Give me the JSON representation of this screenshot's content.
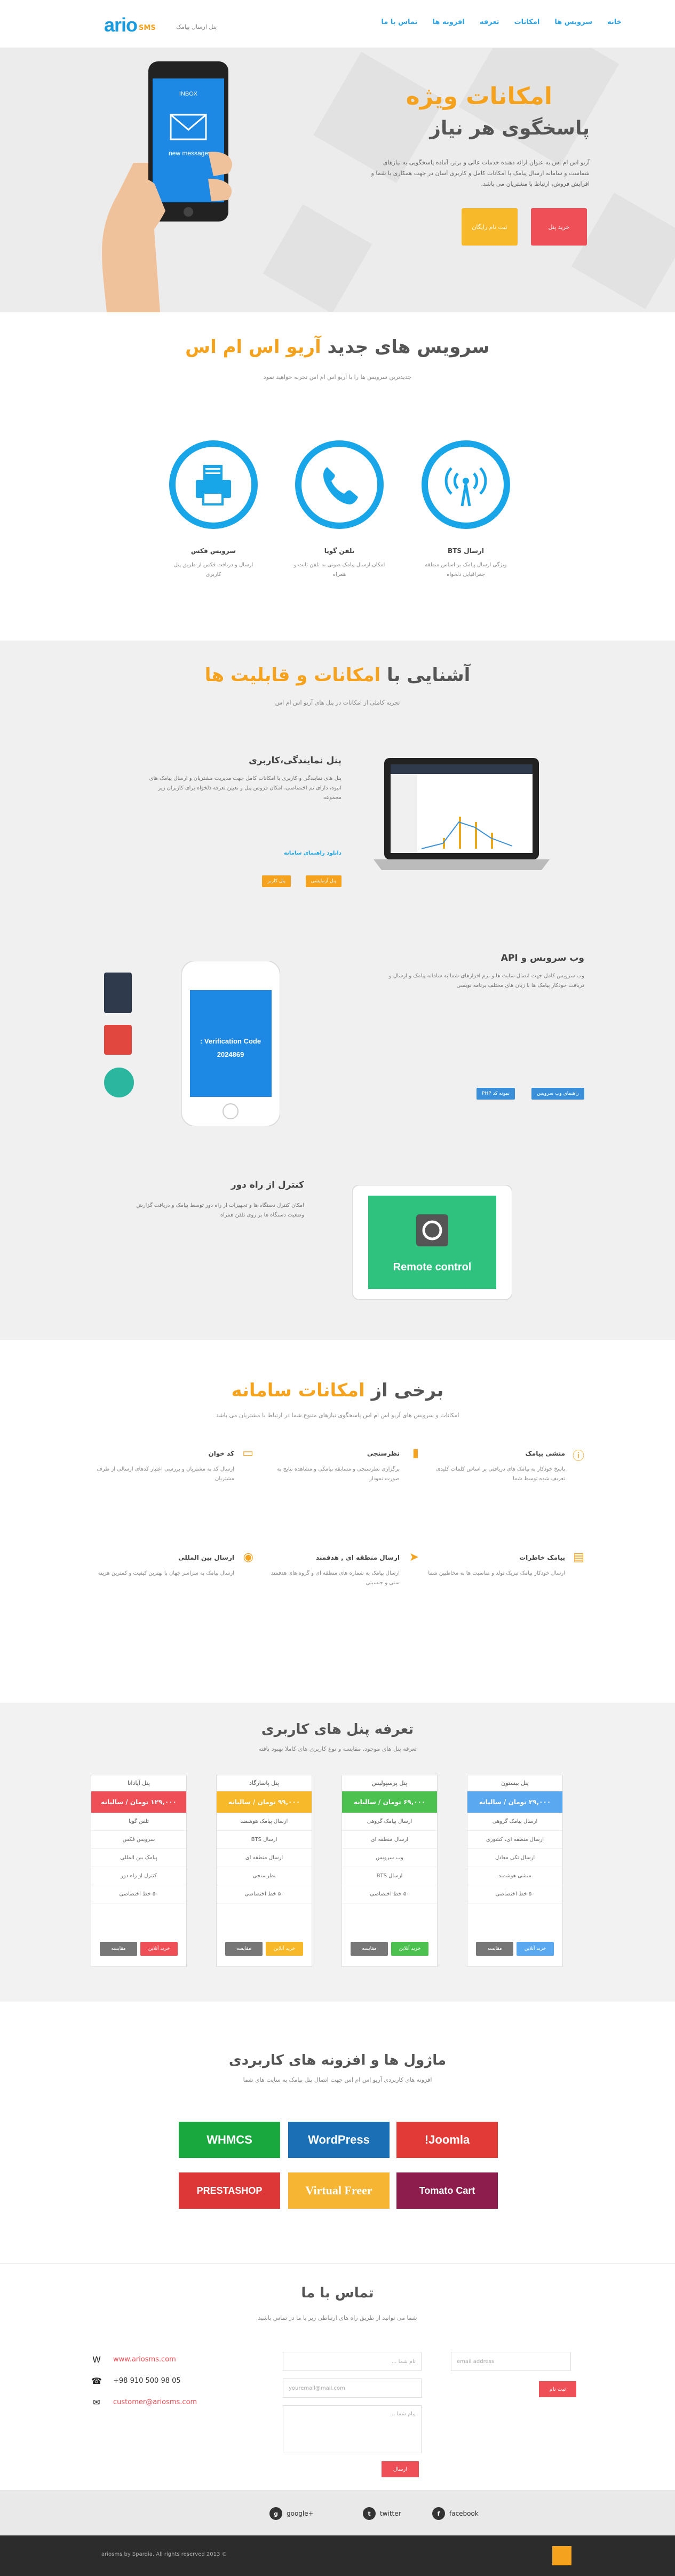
{
  "header": {
    "nav": [
      "خانه",
      "سرویس ها",
      "امکانات",
      "تعرفه",
      "افزونه ها",
      "تماس با ما"
    ],
    "logo_main": "ario",
    "logo_sub": "SMS",
    "tagline": "پنل ارسال پیامک"
  },
  "hero": {
    "title_line1": "امکانات ویژه",
    "title_line2": "پاسخگوی هر نیاز",
    "description": "آریو اس ام اس به عنوان ارائه دهنده خدمات عالی و برتر، آماده پاسخگویی به نیازهای شماست و سامانه ارسال پیامک با امکانات کامل و کاربری آسان در جهت همکاری با شما و افزایش فروش، ارتباط با مشتریان می باشد.",
    "btn_register": "ثبت نام رایگان",
    "btn_buy": "خرید پنل",
    "phone_inbox": "INBOX",
    "phone_msg": "new message"
  },
  "services": {
    "title_a": "سرویس های جدید",
    "title_b": "آریو اس ام اس",
    "subtitle": "جدیدترین سرویس ها را با آریو اس ام اس تجربه خواهید نمود",
    "items": [
      {
        "title": "ارسال BTS",
        "desc": "ویژگی ارسال پیامک بر اساس منطقه جغرافیایی دلخواه"
      },
      {
        "title": "تلفن گویا",
        "desc": "امکان ارسال پیامک صوتی به تلفن ثابت و همراه"
      },
      {
        "title": "سرویس فکس",
        "desc": "ارسال و دریافت فکس از طریق پنل کاربری"
      }
    ]
  },
  "features": {
    "title_a": "آشنایی با",
    "title_b": "امکانات و قابلیت ها",
    "subtitle": "تجربه کاملی از امکانات در پنل های آریو اس ام اس",
    "panel": {
      "title": "پنل نمایندگی،کاربری",
      "desc": "پنل های نمایندگی و کاربری با امکانات کامل جهت مدیریت مشتریان و ارسال پیامک های انبوه، دارای تم اختصاصی، امکان فروش پنل و تعیین تعرفه دلخواه برای کاربران زیر مجموعه",
      "link": "دانلود راهنمای سامانه",
      "btn1": "پنل آزمایشی",
      "btn2": "پنل کاربر"
    },
    "webservice": {
      "title": "وب سرویس و API",
      "desc": "وب سرویس کامل جهت اتصال سایت ها و نرم افزارهای شما به سامانه پیامک و ارسال و دریافت خودکار پیامک ها با زبان های مختلف برنامه نویسی",
      "btn1": "راهنمای وب سرویس",
      "btn2": "نمونه کد PHP",
      "phone_text_1": "Verification Code :",
      "phone_text_2": "2024869"
    },
    "remote": {
      "title": "کنترل از راه دور",
      "desc": "امکان کنترل دستگاه ها و تجهیزات از راه دور توسط پیامک و دریافت گزارش وضعیت دستگاه ها بر روی تلفن همراه",
      "tablet_text": "Remote control"
    }
  },
  "facilities": {
    "title_a": "برخی از",
    "title_b": "امکانات سامانه",
    "subtitle": "امکانات و سرویس های آریو اس ام اس پاسخگوی نیازهای متنوع شما در ارتباط با مشتریان می باشد",
    "items": [
      {
        "title": "منشی پیامک",
        "desc": "پاسخ خودکار به پیامک های دریافتی بر اساس کلمات کلیدی تعریف شده توسط شما"
      },
      {
        "title": "نظرسنجی",
        "desc": "برگزاری نظرسنجی و مسابقه پیامکی و مشاهده نتایج به صورت نمودار"
      },
      {
        "title": "کد خوان",
        "desc": "ارسال کد به مشتریان و بررسی اعتبار کدهای ارسالی از طرف مشتریان"
      },
      {
        "title": "پیامک خاطرات",
        "desc": "ارسال خودکار پیامک تبریک تولد و مناسبت ها به مخاطبین شما"
      },
      {
        "title": "ارسال منطقه ای , هدفمند",
        "desc": "ارسال پیامک به شماره های منطقه ای و گروه های هدفمند سنی و جنسیتی"
      },
      {
        "title": "ارسال بین المللی",
        "desc": "ارسال پیامک به سراسر جهان با بهترین کیفیت و کمترین هزینه"
      }
    ]
  },
  "pricing": {
    "title": "تعرفه پنل های کاربری",
    "subtitle": "تعرفه پنل های موجود، مقایسه و نوع کاربری های کاملا بهبود یافته",
    "plans": [
      {
        "name": "پنل بیستون",
        "price": "۲۹,۰۰۰ تومان / سالیانه",
        "color": "#5aa9f0",
        "rows": [
          "ارسال پیامک گروهی",
          "ارسال منطقه ای، کشوری",
          "ارسال تکی معادل",
          "منشی هوشمند",
          "۵۰ خط اختصاصی"
        ]
      },
      {
        "name": "پنل پرسپولیس",
        "price": "۶۹,۰۰۰ تومان / سالیانه",
        "color": "#4cc14f",
        "rows": [
          "ارسال پیامک گروهی",
          "ارسال منطقه ای",
          "وب سرویس",
          "ارسال BTS",
          "۵۰ خط اختصاصی"
        ]
      },
      {
        "name": "پنل پاسارگاد",
        "price": "۹۹,۰۰۰ تومان / سالیانه",
        "color": "#f7b82a",
        "rows": [
          "ارسال پیامک هوشمند",
          "ارسال BTS",
          "ارسال منطقه ای",
          "نظرسنجی",
          "۵۰ خط اختصاصی"
        ]
      },
      {
        "name": "پنل آپادانا",
        "price": "۱۲۹,۰۰۰ تومان / سالیانه",
        "color": "#ef4f56",
        "rows": [
          "تلفن گویا",
          "سرویس فکس",
          "پیامک بین المللی",
          "کنترل از راه دور",
          "۵۰ خط اختصاصی"
        ]
      }
    ],
    "btn_buy": "خرید آنلاین",
    "btn_compare": "مقایسه"
  },
  "modules": {
    "title": "ماژول ها و افزونه های کاربردی",
    "subtitle": "افزونه های کاربردی آریو اس ام اس جهت اتصال پنل پیامک به سایت های شما",
    "items": [
      {
        "name": "WHMCS",
        "color": "#19a83e"
      },
      {
        "name": "WordPress",
        "color": "#1b70b5"
      },
      {
        "name": "Joomla!",
        "color": "#e23a36"
      },
      {
        "name": "PRESTASHOP",
        "color": "#de3737"
      },
      {
        "name": "Virtual Freer",
        "color": "#f6b634"
      },
      {
        "name": "Tomato Cart",
        "color": "#8c1d4c"
      }
    ]
  },
  "contact": {
    "title": "تماس با ما",
    "subtitle": "شما می توانید از طریق راه های ارتباطی زیر با ما در تماس باشید",
    "email_ph": "email address",
    "name_ph": "نام شما ...",
    "email2_ph": "youremail@mail.com",
    "message_ph": "پیام شما ...",
    "btn_subscribe": "ثبت نام",
    "btn_send": "ارسال",
    "website": "www.ariosms.com",
    "phone": "+98 910 500 98 05",
    "email": "customer@ariosms.com"
  },
  "social": {
    "google": "google+",
    "twitter": "twitter",
    "facebook": "facebook"
  },
  "footer": {
    "copyright": "ariosms by Spardia. All rights reserved 2013 ©"
  },
  "colors": {
    "blue": "#18a6e8",
    "orange": "#f5a21e",
    "red": "#ef4f56"
  }
}
